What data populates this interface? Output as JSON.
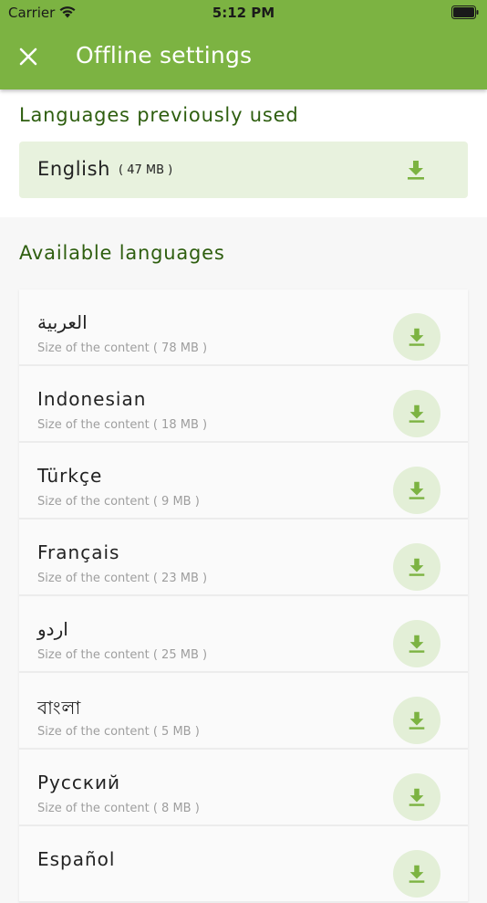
{
  "status_bar": {
    "carrier": "Carrier",
    "time": "5:12 PM",
    "icons": [
      "wifi-icon",
      "battery-icon"
    ]
  },
  "header": {
    "title": "Offline settings",
    "close_icon": "close-icon",
    "background": "#7cb342"
  },
  "previous": {
    "title": "Languages previously used",
    "item": {
      "name": "English",
      "size": "( 47 MB )",
      "icon": "download-icon"
    }
  },
  "available": {
    "title": "Available languages",
    "items": [
      {
        "name": "العربية",
        "size": "Size of the content ( 78 MB )"
      },
      {
        "name": "Indonesian",
        "size": "Size of the content ( 18 MB )"
      },
      {
        "name": "Türkçe",
        "size": "Size of the content ( 9 MB )"
      },
      {
        "name": "Français",
        "size": "Size of the content ( 23 MB )"
      },
      {
        "name": "اردو",
        "size": "Size of the content ( 25 MB )"
      },
      {
        "name": "বাংলা",
        "size": "Size of the content ( 5 MB )"
      },
      {
        "name": "Русский",
        "size": "Size of the content ( 8 MB )"
      },
      {
        "name": "Español",
        "size": ""
      }
    ]
  },
  "colors": {
    "accent": "#7cb342",
    "section_title": "#2e5e0f",
    "icon_green": "#7cb342",
    "download_bg": "#e3efd7",
    "selected_card": "#e8f2de"
  }
}
